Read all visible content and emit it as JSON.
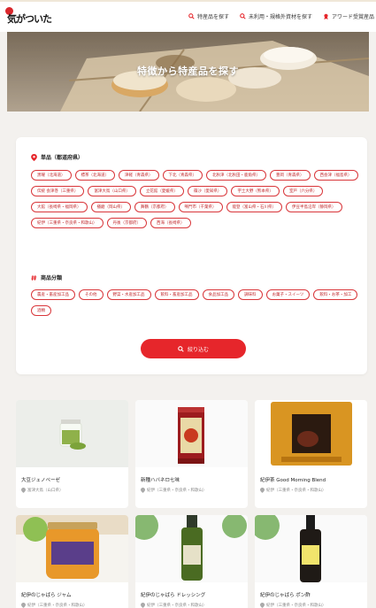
{
  "header": {
    "logo_text": "気がついた",
    "nav": [
      {
        "icon": "search-icon",
        "label": "特産品を探す"
      },
      {
        "icon": "search-icon",
        "label": "未利用・規格外資材を探す"
      },
      {
        "icon": "award-icon",
        "label": "アワード受賞産品"
      }
    ]
  },
  "hero": {
    "title": "特徴から特産品を探す"
  },
  "filters": {
    "region": {
      "title": "単品（都道府県）",
      "tags": [
        "黒曜（北海道）",
        "標茶（北海道）",
        "津軽（青森県）",
        "下北（青森県）",
        "北秋津（北秋田・鹿角県）",
        "豊岡（青森県）",
        "西会津（福島県）",
        "伝統 会津巻（三重県）",
        "富津大鳥（山口県）",
        "立花館（愛媛県）",
        "篠沙（愛知県）",
        "宇土大野（熊本県）",
        "室戸（六分県）",
        "大館（長崎県・福岡県）",
        "播磨（岡山県）",
        "舞鶴（京都府）",
        "鳴門市（千葉県）",
        "能登（富山県・石川県）",
        "伊豆半島沿岸（静岡県）",
        "紀伊（三重県・奈良県・和歌山）",
        "丹後（京都府）",
        "西海（長崎県）"
      ]
    },
    "category": {
      "title": "商品分類",
      "tags": [
        "農産・畜産加工品",
        "その他",
        "野菜・水産加工品",
        "飲料・畜産加工品",
        "食品加工品",
        "調味料",
        "お菓子・スイーツ",
        "飲料・お茶・加工",
        "酒類"
      ]
    },
    "search_label": "絞り込む"
  },
  "products": [
    {
      "name": "大豆ジェノベーゼ",
      "location": "富津大鳥（山口県）",
      "image": "jar-green"
    },
    {
      "name": "新種ハバネロ七味",
      "location": "紀伊（三重県・奈良県・和歌山）",
      "image": "spice-can"
    },
    {
      "name": "紀伊茶 Good Morning Blend",
      "location": "紀伊（三重県・奈良県・和歌山）",
      "image": "tea-pouch"
    },
    {
      "name": "紀伊のじゃばら ジャム",
      "location": "紀伊（三重県・奈良県・和歌山）",
      "image": "jam-jar"
    },
    {
      "name": "紀伊のじゃばら ドレッシング",
      "location": "紀伊（三重県・奈良県・和歌山）",
      "image": "dressing-bottle"
    },
    {
      "name": "紀伊のじゃばら ポン酢",
      "location": "紀伊（三重県・奈良県・和歌山）",
      "image": "ponzu-bottle"
    }
  ],
  "colors": {
    "accent": "#e6262b",
    "background": "#f3f1ee"
  }
}
